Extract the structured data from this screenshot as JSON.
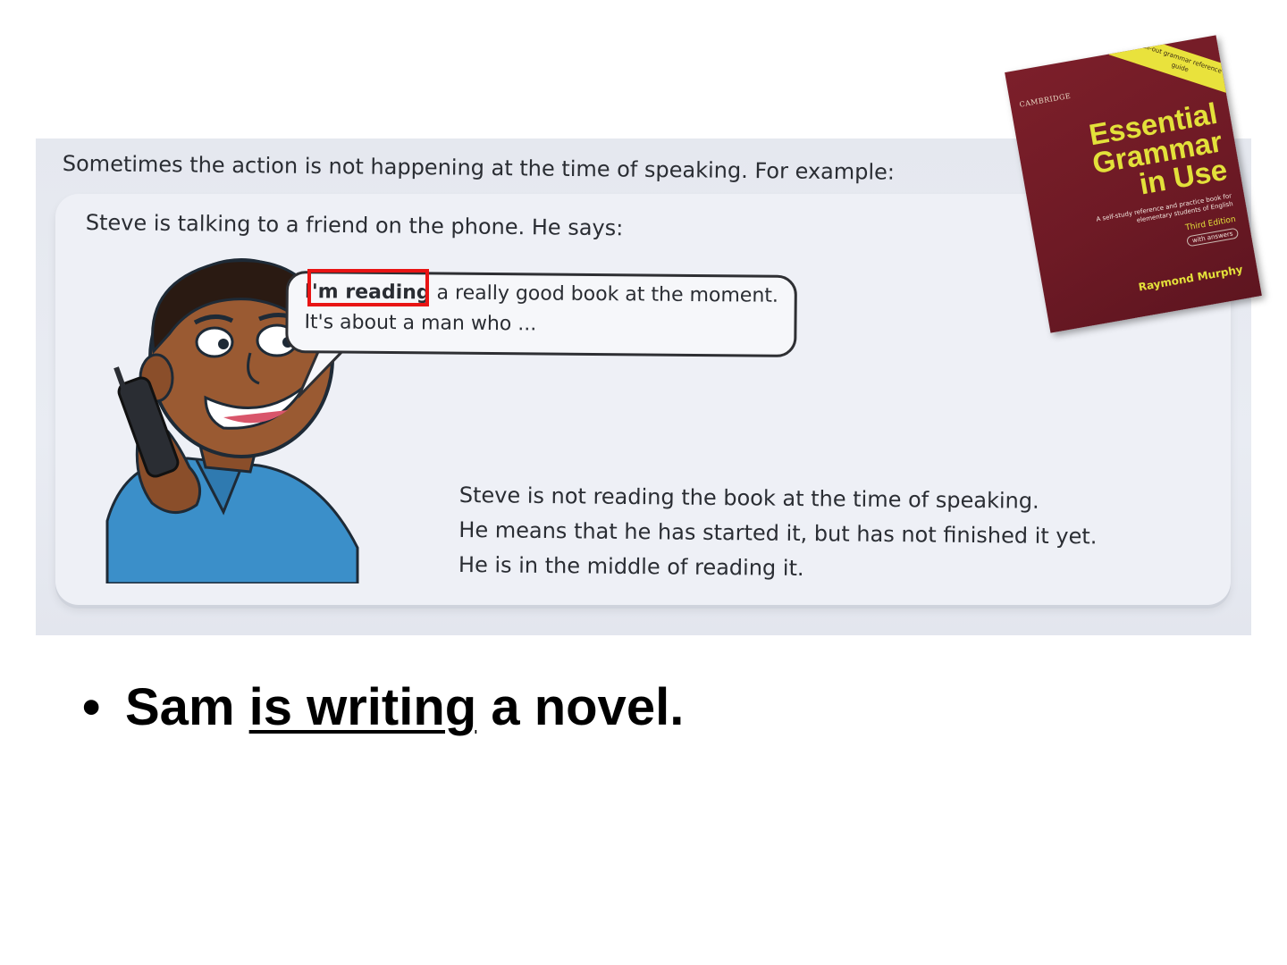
{
  "textbook": {
    "intro": "Sometimes the action is not happening at the time of speaking.  For example:",
    "scene": "Steve is talking to a friend on the phone.  He says:",
    "bubble": {
      "bold_part": "I'm reading",
      "line1_rest": " a really good book at the moment.",
      "line2": "It's about a man who ..."
    },
    "explanation": [
      "Steve is not reading the book at the time of speaking.",
      "He means that he has started it, but has not finished it yet.",
      "He is in the middle of reading it."
    ],
    "highlight_color": "#e81414"
  },
  "book_cover": {
    "banner": "FREE Pull-out grammar reference pocket guide",
    "publisher": "CAMBRIDGE",
    "title_lines": [
      "Essential",
      "Grammar",
      "in Use"
    ],
    "subtitle": "A self-study reference and practice book for elementary students of English",
    "edition": "Third Edition",
    "answers": "with answers",
    "author": "Raymond Murphy",
    "cover_color": "#6e1a25",
    "title_color": "#e3e13a"
  },
  "bullet": {
    "marker": "•",
    "subject": "Sam ",
    "verb": "is writing",
    "rest": " a novel."
  }
}
